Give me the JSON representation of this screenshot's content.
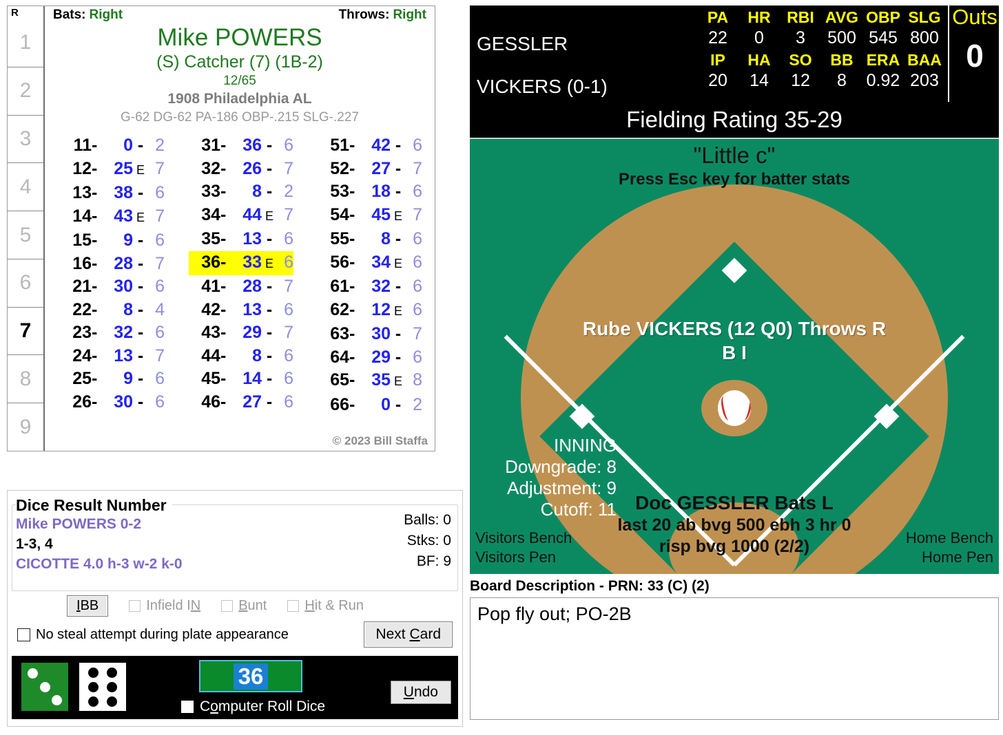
{
  "player_card": {
    "inning_header": "R",
    "innings": [
      {
        "label": "1",
        "active": false
      },
      {
        "label": "2",
        "active": false
      },
      {
        "label": "3",
        "active": false
      },
      {
        "label": "4",
        "active": false
      },
      {
        "label": "5",
        "active": false
      },
      {
        "label": "6",
        "active": false
      },
      {
        "label": "7",
        "active": true
      },
      {
        "label": "8",
        "active": false
      },
      {
        "label": "9",
        "active": false
      }
    ],
    "bats_label": "Bats:",
    "bats_value": "Right",
    "throws_label": "Throws:",
    "throws_value": "Right",
    "name": "Mike POWERS",
    "position": "(S) Catcher (7) (1B-2)",
    "number": "12/65",
    "team": "1908 Philadelphia AL",
    "stats": "G-62 DG-62 PA-186 OBP-.215 SLG-.227",
    "copyright": "© 2023 Bill Staffa",
    "columns": [
      [
        {
          "code": "11",
          "result": "0",
          "sep": "-",
          "tail": "2",
          "hl": false
        },
        {
          "code": "12",
          "result": "25",
          "sep": "E",
          "tail": "7",
          "hl": false
        },
        {
          "code": "13",
          "result": "38",
          "sep": "-",
          "tail": "6",
          "hl": false
        },
        {
          "code": "14",
          "result": "43",
          "sep": "E",
          "tail": "7",
          "hl": false
        },
        {
          "code": "15",
          "result": "9",
          "sep": "-",
          "tail": "6",
          "hl": false
        },
        {
          "code": "16",
          "result": "28",
          "sep": "-",
          "tail": "7",
          "hl": false
        },
        {
          "code": "21",
          "result": "30",
          "sep": "-",
          "tail": "6",
          "hl": false
        },
        {
          "code": "22",
          "result": "8",
          "sep": "-",
          "tail": "4",
          "hl": false
        },
        {
          "code": "23",
          "result": "32",
          "sep": "-",
          "tail": "6",
          "hl": false
        },
        {
          "code": "24",
          "result": "13",
          "sep": "-",
          "tail": "7",
          "hl": false
        },
        {
          "code": "25",
          "result": "9",
          "sep": "-",
          "tail": "6",
          "hl": false
        },
        {
          "code": "26",
          "result": "30",
          "sep": "-",
          "tail": "6",
          "hl": false
        }
      ],
      [
        {
          "code": "31",
          "result": "36",
          "sep": "-",
          "tail": "6",
          "hl": false
        },
        {
          "code": "32",
          "result": "26",
          "sep": "-",
          "tail": "7",
          "hl": false
        },
        {
          "code": "33",
          "result": "8",
          "sep": "-",
          "tail": "2",
          "hl": false
        },
        {
          "code": "34",
          "result": "44",
          "sep": "E",
          "tail": "7",
          "hl": false
        },
        {
          "code": "35",
          "result": "13",
          "sep": "-",
          "tail": "6",
          "hl": false
        },
        {
          "code": "36",
          "result": "33",
          "sep": "E",
          "tail": "6",
          "hl": true
        },
        {
          "code": "41",
          "result": "28",
          "sep": "-",
          "tail": "7",
          "hl": false
        },
        {
          "code": "42",
          "result": "13",
          "sep": "-",
          "tail": "6",
          "hl": false
        },
        {
          "code": "43",
          "result": "29",
          "sep": "-",
          "tail": "7",
          "hl": false
        },
        {
          "code": "44",
          "result": "8",
          "sep": "-",
          "tail": "6",
          "hl": false
        },
        {
          "code": "45",
          "result": "14",
          "sep": "-",
          "tail": "6",
          "hl": false
        },
        {
          "code": "46",
          "result": "27",
          "sep": "-",
          "tail": "6",
          "hl": false
        }
      ],
      [
        {
          "code": "51",
          "result": "42",
          "sep": "-",
          "tail": "6",
          "hl": false
        },
        {
          "code": "52",
          "result": "27",
          "sep": "-",
          "tail": "7",
          "hl": false
        },
        {
          "code": "53",
          "result": "18",
          "sep": "-",
          "tail": "6",
          "hl": false
        },
        {
          "code": "54",
          "result": "45",
          "sep": "E",
          "tail": "7",
          "hl": false
        },
        {
          "code": "55",
          "result": "8",
          "sep": "-",
          "tail": "6",
          "hl": false
        },
        {
          "code": "56",
          "result": "34",
          "sep": "E",
          "tail": "6",
          "hl": false
        },
        {
          "code": "61",
          "result": "32",
          "sep": "-",
          "tail": "6",
          "hl": false
        },
        {
          "code": "62",
          "result": "12",
          "sep": "E",
          "tail": "6",
          "hl": false
        },
        {
          "code": "63",
          "result": "30",
          "sep": "-",
          "tail": "7",
          "hl": false
        },
        {
          "code": "64",
          "result": "29",
          "sep": "-",
          "tail": "6",
          "hl": false
        },
        {
          "code": "65",
          "result": "35",
          "sep": "E",
          "tail": "8",
          "hl": false
        },
        {
          "code": "66",
          "result": "0",
          "sep": "-",
          "tail": "2",
          "hl": false
        }
      ]
    ]
  },
  "dice_panel": {
    "legend": "Dice Result Number",
    "line1": "Mike POWERS  0-2",
    "line2": "1-3, 4",
    "line3": "CICOTTE  4.0  h-3  w-2  k-0",
    "balls": "Balls: 0",
    "strikes": "Stks: 0",
    "bf": "BF: 9",
    "ibb_button": "IBB",
    "infield_in": "Infield IN",
    "bunt": "Bunt",
    "hit_and_run": "Hit & Run",
    "no_steal": "No steal attempt during plate appearance",
    "next_card": "Next Card",
    "roll_value": "36",
    "computer_roll": "Computer Roll Dice",
    "undo": "Undo",
    "die_left_value": 3,
    "die_right_value": 6,
    "die_left_color": "#1f8a2a",
    "die_right_color": "#ffffff"
  },
  "scoreboard": {
    "batter_name": "GESSLER",
    "pitcher_name": "VICKERS (0-1)",
    "batter_headers": [
      "PA",
      "HR",
      "RBI",
      "AVG",
      "OBP",
      "SLG"
    ],
    "batter_values": [
      "22",
      "0",
      "3",
      "500",
      "545",
      "800"
    ],
    "pitcher_headers": [
      "IP",
      "HA",
      "SO",
      "BB",
      "ERA",
      "BAA"
    ],
    "pitcher_values": [
      "20",
      "14",
      "12",
      "8",
      "0.92",
      "203"
    ],
    "outs_label": "Outs",
    "outs_value": "0",
    "header_color": "#ffff00"
  },
  "fielding_bar": "Fielding Rating 35-29",
  "field": {
    "little_c": "\"Little c\"",
    "esc_hint": "Press Esc key for batter stats",
    "pitcher_line1": "Rube VICKERS (12 Q0) Throws R",
    "pitcher_line2": "B I",
    "inning_label": "INNING",
    "downgrade": "Downgrade: 8",
    "adjustment": "Adjustment: 9",
    "cutoff": "Cutoff: 11",
    "batter_name": "Doc GESSLER Bats L",
    "batter_sub1": "last 20 ab bvg 500 ebh 3 hr 0",
    "batter_sub2": "risp bvg 1000 (2/2)",
    "visitors_bench": "Visitors Bench",
    "visitors_pen": "Visitors Pen",
    "home_bench": "Home Bench",
    "home_pen": "Home Pen",
    "grass_color": "#0b8a62",
    "dirt_color": "#bf9150"
  },
  "board": {
    "label": "Board Description - PRN: 33 (C) (2)",
    "text": "Pop fly out; PO-2B"
  }
}
